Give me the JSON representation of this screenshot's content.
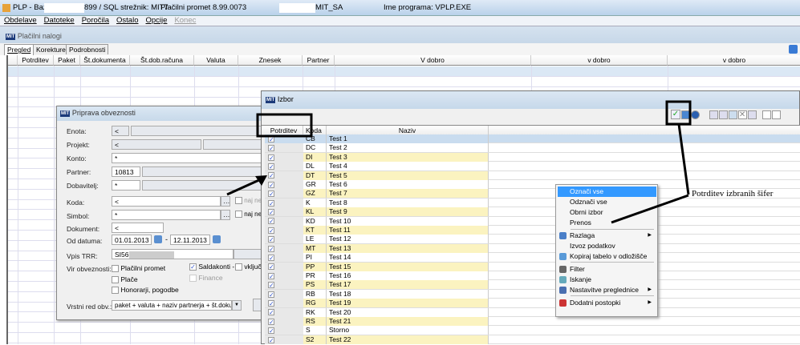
{
  "titlebar": {
    "app": "PLP - Baza:",
    "server": "899 / SQL strežnik: MIT7",
    "version": "Plačilni promet 8.99.0073",
    "user": "MIT_SA",
    "program": "Ime programa: VPLP.EXE"
  },
  "menu": [
    "Obdelave",
    "Datoteke",
    "Poročila",
    "Ostalo",
    "Opcije",
    "Konec"
  ],
  "mdi": {
    "logo": "MIT",
    "title": "Plačilni nalogi"
  },
  "tabs": [
    "Pregled",
    "Korekture",
    "Podrobnosti"
  ],
  "grid_columns": [
    "Potrditev",
    "Paket",
    "Št.dokumenta",
    "Št.dob.računa",
    "Valuta",
    "Znesek",
    "Partner",
    "V dobro",
    "v dobro",
    "v dobro"
  ],
  "dialog": {
    "title": "Priprava obveznosti",
    "fields": {
      "enota": {
        "label": "Enota:",
        "value": "<"
      },
      "projekt": {
        "label": "Projekt:",
        "value": "<"
      },
      "konto": {
        "label": "Konto:",
        "value": "*"
      },
      "partner": {
        "label": "Partner:",
        "value": "10813"
      },
      "dobavitelj": {
        "label": "Dobavitelj:",
        "value": "*"
      },
      "koda": {
        "label": "Koda:",
        "value": "<"
      },
      "simbol": {
        "label": "Simbol:",
        "value": "*"
      },
      "dokument": {
        "label": "Dokument:",
        "value": "<"
      },
      "od_datuma": {
        "label": "Od datuma:",
        "from": "01.01.2013",
        "to": "12.11.2013"
      },
      "trr": {
        "label": "Vpis TRR:",
        "value": "SI56"
      }
    },
    "naj_ne": "naj ne",
    "vir_label": "Vir obveznosti:",
    "vir": [
      {
        "label": "Plačilni promet",
        "checked": false
      },
      {
        "label": "Plače",
        "checked": false
      },
      {
        "label": "Honorarji, pogodbe",
        "checked": false
      },
      {
        "label": "Saldakonti -",
        "checked": true
      },
      {
        "label": "Finance",
        "checked": false,
        "disabled": true
      },
      {
        "label": "vključ",
        "checked": false
      }
    ],
    "sort_label": "Vrstni red obv.:",
    "sort_value": "paket + valuta + naziv partnerja + št.dokumer"
  },
  "izbor": {
    "logo": "MIT",
    "title": "Izbor",
    "columns": [
      "Potrditev",
      "Koda",
      "Naziv"
    ],
    "rows": [
      [
        "CB",
        "Test 1"
      ],
      [
        "DC",
        "Test 2"
      ],
      [
        "DI",
        "Test 3"
      ],
      [
        "DL",
        "Test 4"
      ],
      [
        "DT",
        "Test 5"
      ],
      [
        "GR",
        "Test 6"
      ],
      [
        "GZ",
        "Test 7"
      ],
      [
        "K",
        "Test 8"
      ],
      [
        "KL",
        "Test 9"
      ],
      [
        "KD",
        "Test 10"
      ],
      [
        "KT",
        "Test 11"
      ],
      [
        "LE",
        "Test 12"
      ],
      [
        "MT",
        "Test 13"
      ],
      [
        "PI",
        "Test 14"
      ],
      [
        "PP",
        "Test 15"
      ],
      [
        "PR",
        "Test 16"
      ],
      [
        "PS",
        "Test 17"
      ],
      [
        "RB",
        "Test 18"
      ],
      [
        "RG",
        "Test 19"
      ],
      [
        "RK",
        "Test 20"
      ],
      [
        "RS",
        "Test 21"
      ],
      [
        "S",
        "Storno"
      ],
      [
        "S2",
        "Test 22"
      ]
    ]
  },
  "context_menu": [
    {
      "label": "Označi vse",
      "highlighted": true
    },
    {
      "label": "Odznači vse"
    },
    {
      "label": "Obrni izbor"
    },
    {
      "label": "Prenos"
    },
    {
      "label": "Razlaga",
      "submenu": true,
      "icon": "help-icon"
    },
    {
      "label": "Izvoz podatkov"
    },
    {
      "label": "Kopiraj tabelo v odložišče",
      "icon": "copy-icon"
    },
    {
      "label": "Filter",
      "icon": "filter-icon"
    },
    {
      "label": "Iskanje",
      "icon": "search-icon"
    },
    {
      "label": "Nastavitve preglednice",
      "submenu": true,
      "icon": "settings-icon"
    },
    {
      "label": "Dodatni postopki",
      "submenu": true,
      "icon": "tools-icon"
    }
  ],
  "annotation": "Potrditev izbranih šifer",
  "colors": {
    "row_yellow": "#fbf3c0",
    "selected_row": "#c9dcef",
    "menu_highlight": "#3399ff"
  }
}
